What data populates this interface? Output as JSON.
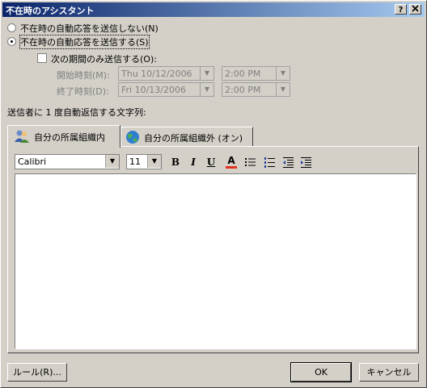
{
  "window": {
    "title": "不在時のアシスタント",
    "help_button": "?",
    "close_button": "X"
  },
  "options": {
    "no_reply": "不在時の自動応答を送信しない(N)",
    "send_reply": "不在時の自動応答を送信する(S)",
    "time_range": "次の期間のみ送信する(O):",
    "start_label": "開始時刻(M):",
    "start_date": "Thu 10/12/2006",
    "start_time": "2:00 PM",
    "end_label": "終了時刻(D):",
    "end_date": "Fri 10/13/2006",
    "end_time": "2:00 PM",
    "once_label": "送信者に 1 度自動返信する文字列:"
  },
  "tabs": [
    {
      "label": "自分の所属組織内"
    },
    {
      "label": "自分の所属組織外 (オン)"
    }
  ],
  "toolbar": {
    "font": "Calibri",
    "size": "11",
    "bold": "B",
    "italic": "I",
    "underline": "U",
    "font_color": "A"
  },
  "colors": {
    "title_start": "#0a246a",
    "title_end": "#a6caf0",
    "font_color_bar": "#e03020"
  },
  "buttons": {
    "rules": "ルール(R)...",
    "ok": "OK",
    "cancel": "キャンセル"
  }
}
